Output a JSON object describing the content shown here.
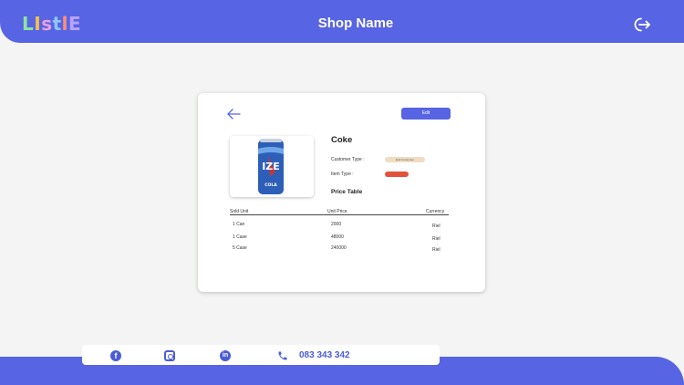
{
  "header": {
    "logo_letters": [
      {
        "char": "L",
        "color": "#8ee3a0"
      },
      {
        "char": "I",
        "color": "#f2c14e"
      },
      {
        "char": "s",
        "color": "#e8a0e0"
      },
      {
        "char": "t",
        "color": "#8fc6ff"
      },
      {
        "char": "l",
        "color": "#ff8e7a"
      },
      {
        "char": "E",
        "color": "#b7a3ff"
      }
    ],
    "shop_name": "Shop Name",
    "logout_icon": "logout-icon"
  },
  "product": {
    "edit_label": "Edit",
    "name": "Coke",
    "customer_type_label": "Customer Type :",
    "customer_type_value": "End Consumer",
    "item_type_label": "Item Type :",
    "item_type_value": "",
    "price_table_title": "Price Table",
    "image_label_top": "IZE",
    "image_label_bottom": "COLA"
  },
  "price_table": {
    "headers": [
      "Sold Unit",
      "Unit Price",
      "Currency"
    ],
    "rows": [
      {
        "unit": "1 Can",
        "price": "2000",
        "currency": "Riel"
      },
      {
        "unit": "1 Case",
        "price": "48000",
        "currency": "Riel"
      },
      {
        "unit": "5 Case",
        "price": "240000",
        "currency": "Riel"
      }
    ]
  },
  "footer": {
    "social_icons": [
      "facebook-icon",
      "instagram-icon",
      "linkedin-icon"
    ],
    "phone": "083 343 342"
  },
  "colors": {
    "brand": "#5764e3",
    "badge_consumer": "#f0dcc3",
    "badge_type": "#e2523a"
  }
}
